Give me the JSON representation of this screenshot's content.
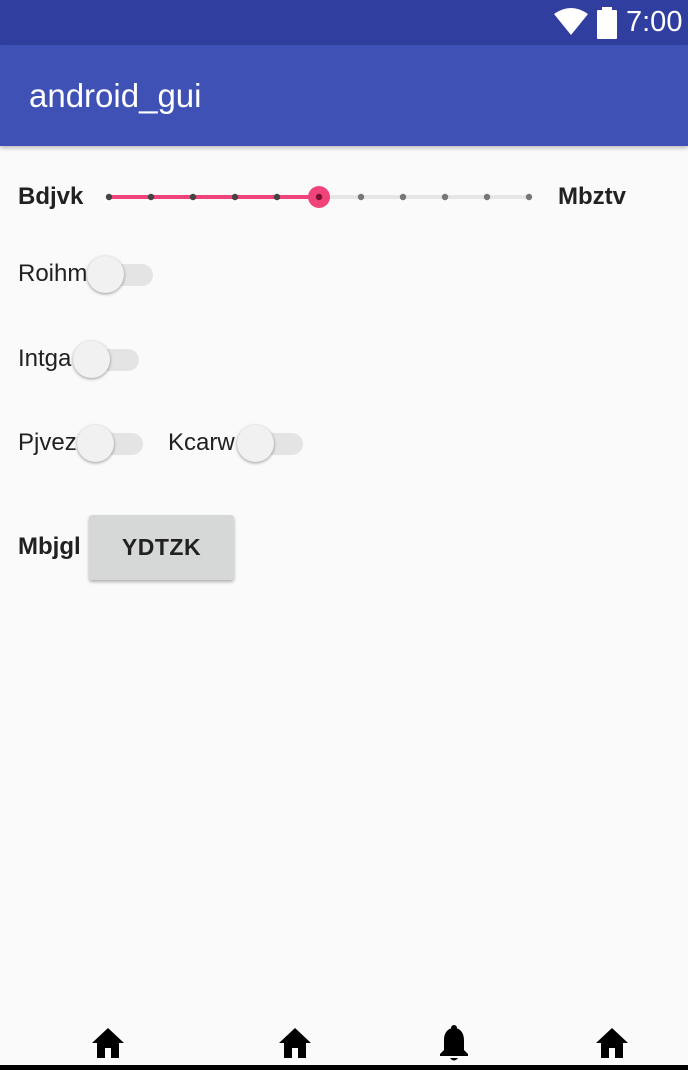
{
  "status_bar": {
    "time": "7:00",
    "icons": [
      "wifi-icon",
      "battery-icon"
    ],
    "color": "#303f9f"
  },
  "app_bar": {
    "title": "android_gui",
    "color": "#3f51b5"
  },
  "slider": {
    "left_label": "Bdjvk",
    "right_label": "Mbztv",
    "steps": 11,
    "value_step": 5,
    "accent_color": "#f0437a"
  },
  "switches": [
    {
      "label": "Roihm",
      "checked": false
    },
    {
      "label": "Intga",
      "checked": false
    },
    {
      "label": "Pjvez",
      "checked": false
    },
    {
      "label": "Kcarw",
      "checked": false
    }
  ],
  "button_row": {
    "label": "Mbjgl",
    "button_text": "YDTZK"
  },
  "bottom_nav": {
    "icons": [
      "home-icon",
      "home-icon",
      "bell-icon",
      "home-icon"
    ]
  }
}
